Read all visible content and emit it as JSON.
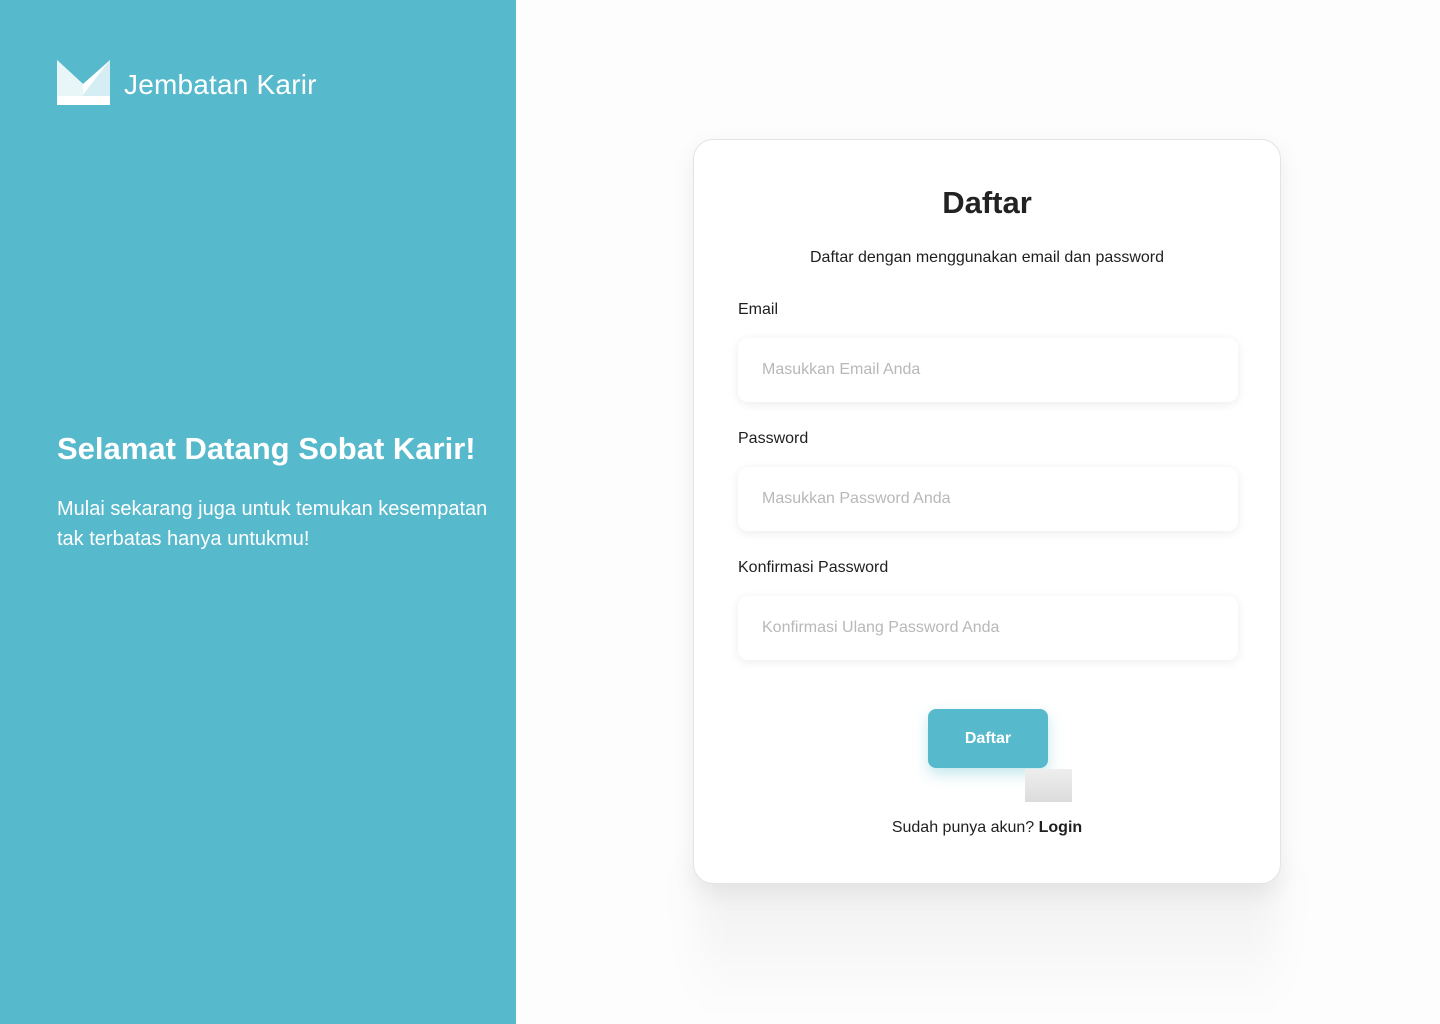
{
  "brand": {
    "name": "Jembatan Karir",
    "logo_icon": "jembatan-karir-logo-icon"
  },
  "welcome": {
    "title": "Selamat Datang Sobat Karir!",
    "text": "Mulai sekarang juga untuk temukan kesempatan tak terbatas hanya untukmu!"
  },
  "form": {
    "title": "Daftar",
    "subtitle": "Daftar dengan menggunakan email dan password",
    "email": {
      "label": "Email",
      "placeholder": "Masukkan Email Anda",
      "value": ""
    },
    "password": {
      "label": "Password",
      "placeholder": "Masukkan Password Anda",
      "value": ""
    },
    "confirm_password": {
      "label": "Konfirmasi Password",
      "placeholder": "Konfirmasi Ulang Password Anda",
      "value": ""
    },
    "submit_label": "Daftar",
    "login_prompt": "Sudah punya akun?",
    "login_link": "Login"
  },
  "colors": {
    "accent": "#57b9cc",
    "background": "#fdfdfd",
    "card": "#ffffff",
    "text": "#1f1f1f",
    "placeholder": "#b8b8b8"
  }
}
